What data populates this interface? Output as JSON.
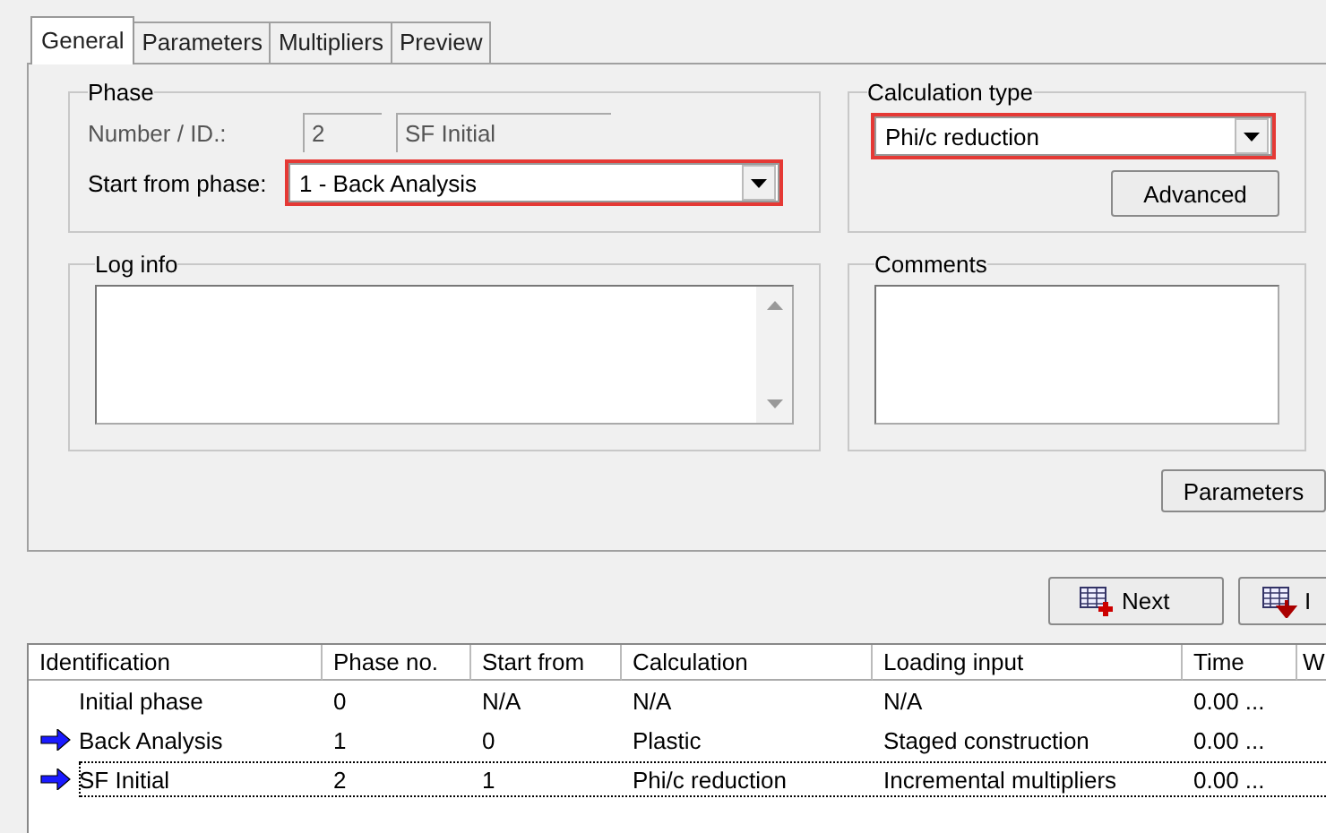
{
  "tabs": [
    {
      "label": "General",
      "selected": true
    },
    {
      "label": "Parameters",
      "selected": false
    },
    {
      "label": "Multipliers",
      "selected": false
    },
    {
      "label": "Preview",
      "selected": false
    }
  ],
  "phase": {
    "title": "Phase",
    "number_label": "Number / ID.:",
    "number": "2",
    "id": "SF Initial",
    "start_label": "Start from phase:",
    "start_value": "1 - Back Analysis"
  },
  "calculation_type": {
    "title": "Calculation type",
    "value": "Phi/c reduction",
    "advanced_button": "Advanced"
  },
  "log_info": {
    "title": "Log info"
  },
  "comments": {
    "title": "Comments"
  },
  "parameters_button": "Parameters",
  "toolbar": [
    {
      "label": "Next",
      "kind": "add"
    },
    {
      "label": "I",
      "kind": "insert"
    }
  ],
  "table": {
    "columns": [
      "Identification",
      "Phase no.",
      "Start from",
      "Calculation",
      "Loading input",
      "Time",
      "W"
    ],
    "rows": [
      {
        "arrow": false,
        "selected": false,
        "cells": [
          "Initial phase",
          "0",
          "N/A",
          "N/A",
          "N/A",
          "0.00 ..."
        ]
      },
      {
        "arrow": true,
        "selected": false,
        "cells": [
          "Back Analysis",
          "1",
          "0",
          "Plastic",
          "Staged construction",
          "0.00 ..."
        ]
      },
      {
        "arrow": true,
        "selected": true,
        "cells": [
          "SF Initial",
          "2",
          "1",
          "Phi/c reduction",
          "Incremental multipliers",
          "0.00 ..."
        ]
      }
    ]
  }
}
